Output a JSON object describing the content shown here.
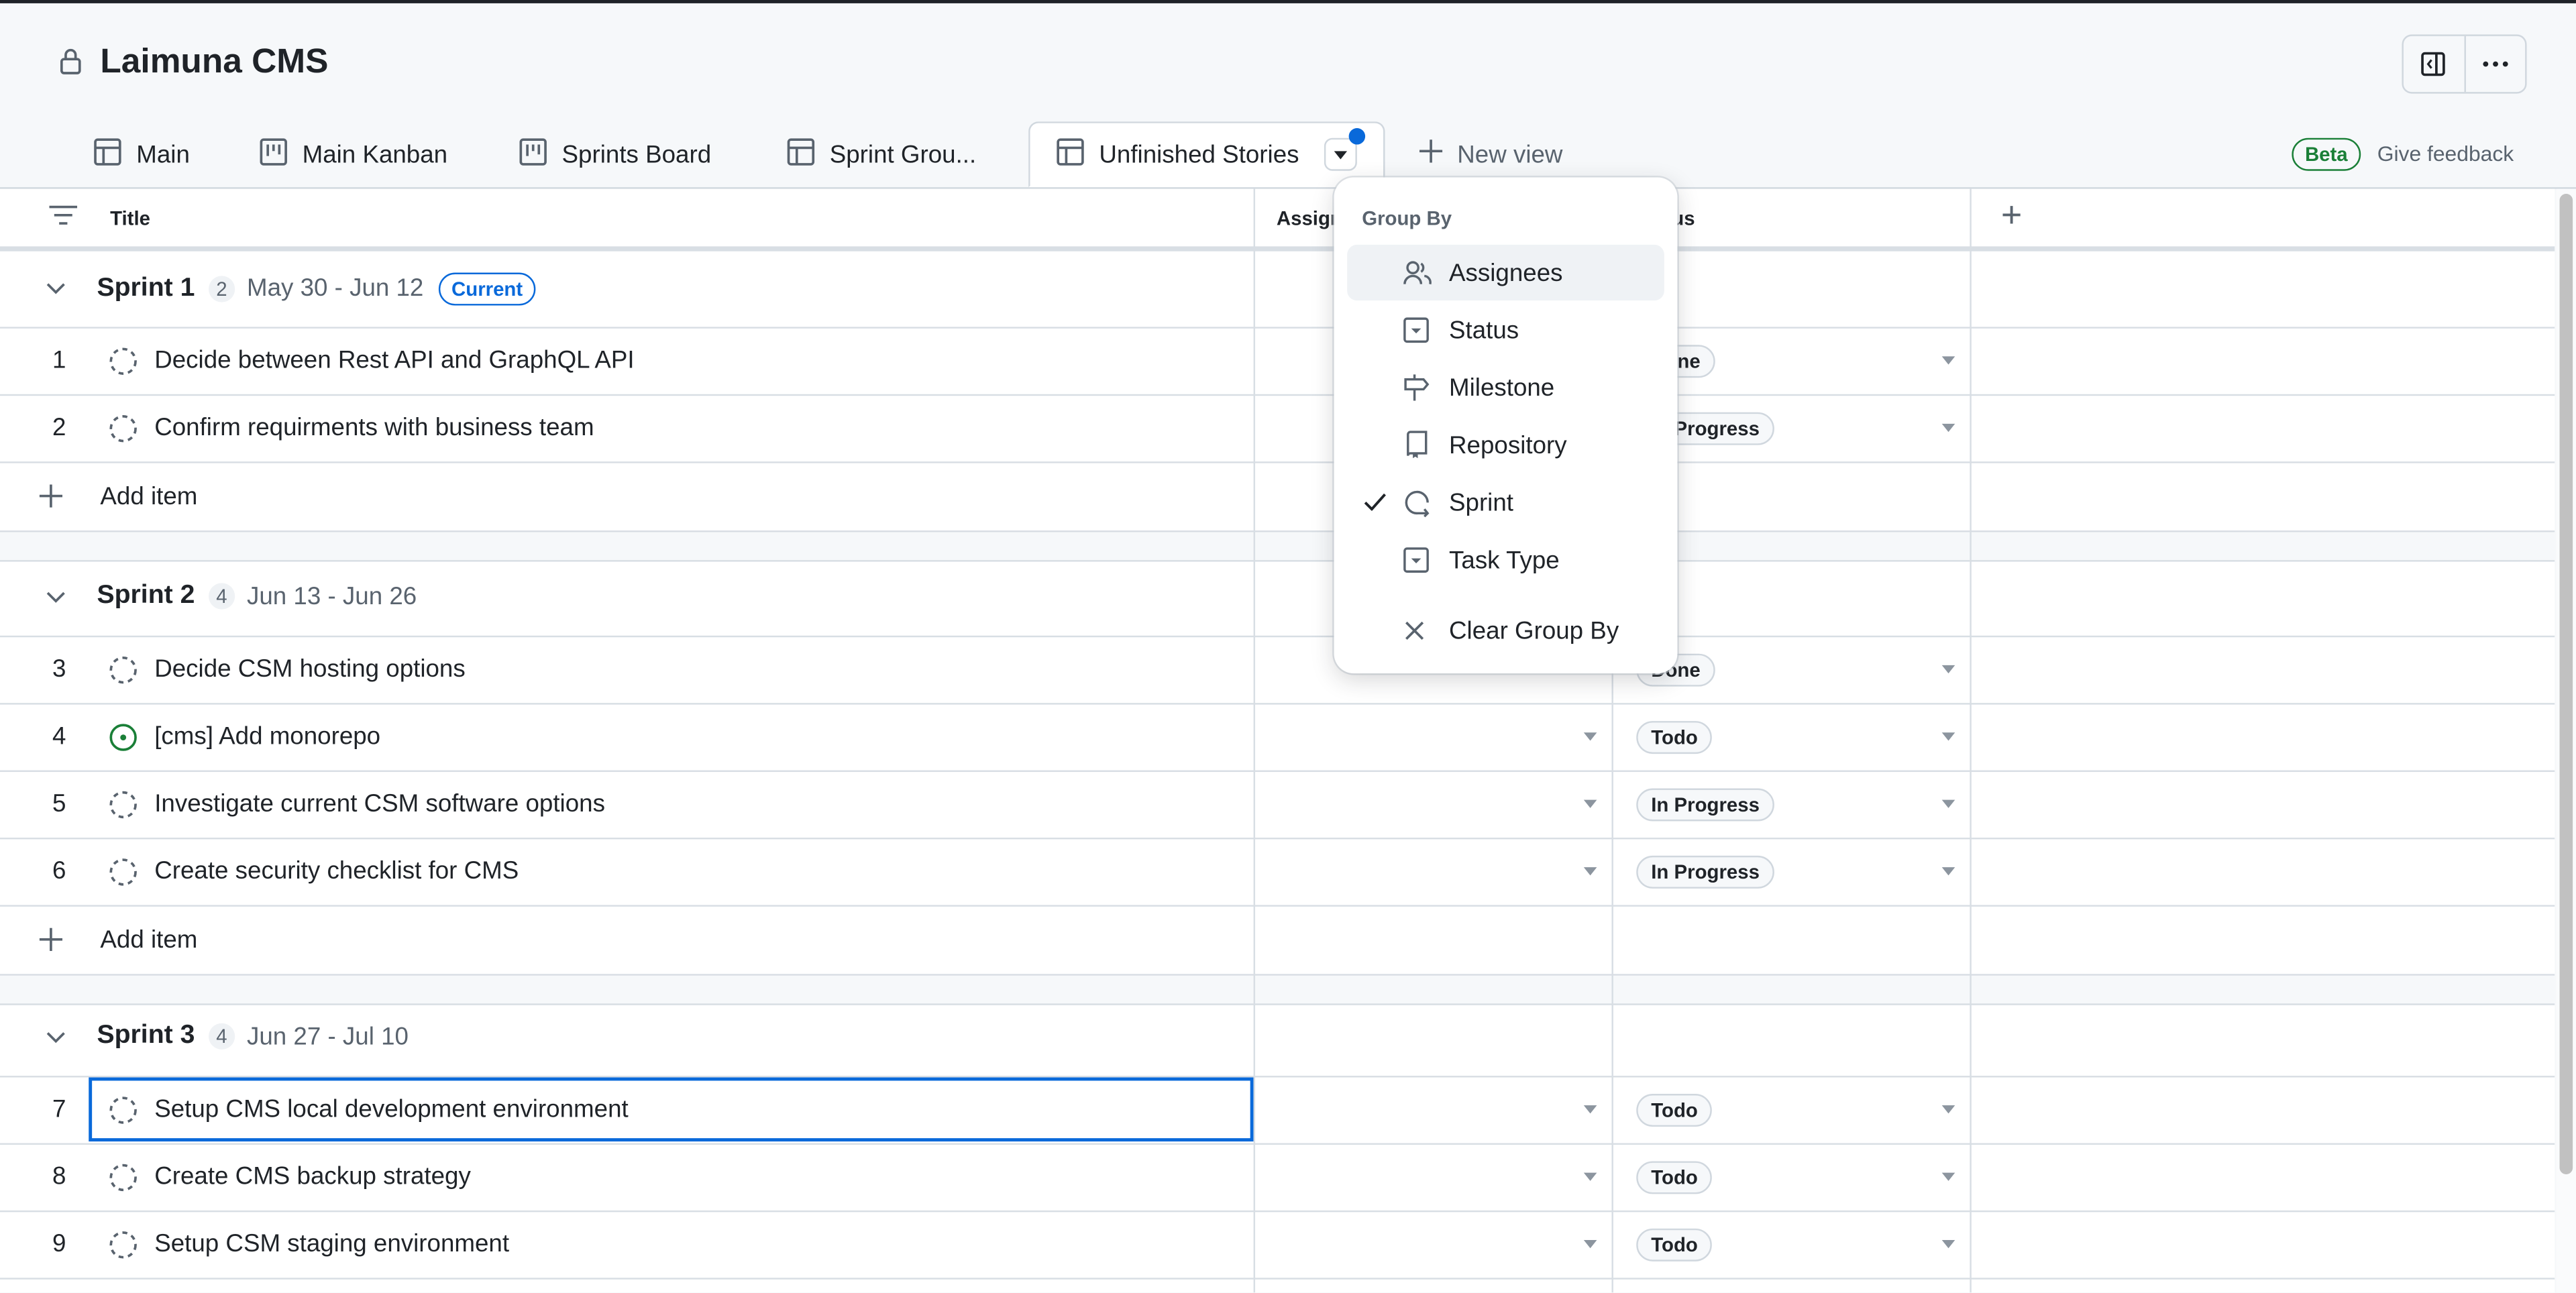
{
  "header": {
    "title": "Laimuna CMS",
    "lock_icon": "lock-icon",
    "panel_icon": "sidebar-toggle-icon",
    "more_icon": "kebab-horizontal-icon"
  },
  "tabs": [
    {
      "label": "Main",
      "icon": "table-icon"
    },
    {
      "label": "Main Kanban",
      "icon": "board-icon"
    },
    {
      "label": "Sprints Board",
      "icon": "board-icon"
    },
    {
      "label": "Sprint Grou...",
      "icon": "table-icon"
    },
    {
      "label": "Unfinished Stories",
      "icon": "table-icon",
      "active": true
    }
  ],
  "new_view": "New view",
  "beta": "Beta",
  "feedback": "Give feedback",
  "columns": {
    "title": "Title",
    "assignees": "Assignees",
    "status": "Status"
  },
  "groups": [
    {
      "name": "Sprint 1",
      "count": "2",
      "dates": "May 30 - Jun 12",
      "badge": "Current",
      "rows": [
        {
          "num": "1",
          "title": "Decide between Rest API and GraphQL API",
          "status": "Done",
          "state": "draft"
        },
        {
          "num": "2",
          "title": "Confirm requirments with business team",
          "status": "In Progress",
          "state": "draft"
        }
      ]
    },
    {
      "name": "Sprint 2",
      "count": "4",
      "dates": "Jun 13 - Jun 26",
      "rows": [
        {
          "num": "3",
          "title": "Decide CSM hosting options",
          "status": "Done",
          "state": "draft"
        },
        {
          "num": "4",
          "title": "[cms] Add monorepo",
          "status": "Todo",
          "state": "open"
        },
        {
          "num": "5",
          "title": "Investigate current CSM software options",
          "status": "In Progress",
          "state": "draft"
        },
        {
          "num": "6",
          "title": "Create security checklist for CMS",
          "status": "In Progress",
          "state": "draft"
        }
      ]
    },
    {
      "name": "Sprint 3",
      "count": "4",
      "dates": "Jun 27 - Jul 10",
      "rows": [
        {
          "num": "7",
          "title": "Setup CMS local development environment",
          "status": "Todo",
          "state": "draft",
          "selected": true
        },
        {
          "num": "8",
          "title": "Create CMS backup strategy",
          "status": "Todo",
          "state": "draft"
        },
        {
          "num": "9",
          "title": "Setup CSM staging environment",
          "status": "Todo",
          "state": "draft"
        }
      ]
    }
  ],
  "add_item": "Add item",
  "menu": {
    "heading": "Group By",
    "items": [
      {
        "label": "Assignees",
        "icon": "people-icon",
        "highlighted": true
      },
      {
        "label": "Status",
        "icon": "single-select-icon"
      },
      {
        "label": "Milestone",
        "icon": "milestone-icon"
      },
      {
        "label": "Repository",
        "icon": "repo-icon"
      },
      {
        "label": "Sprint",
        "icon": "iterations-icon",
        "checked": true
      },
      {
        "label": "Task Type",
        "icon": "single-select-icon"
      }
    ],
    "clear": "Clear Group By"
  },
  "colors": {
    "accent": "#0969da",
    "open": "#1a7f37",
    "beta": "#1a7f37"
  }
}
